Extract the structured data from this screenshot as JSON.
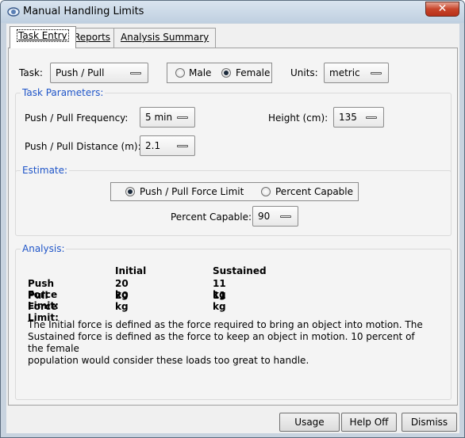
{
  "window": {
    "title": "Manual Handling Limits",
    "close_glyph": "✕"
  },
  "tabs": [
    {
      "label": "Task Entry",
      "active": true
    },
    {
      "label": "Reports",
      "active": false
    },
    {
      "label": "Analysis Summary",
      "active": false
    }
  ],
  "task_row": {
    "task_label": "Task:",
    "task_value": "Push / Pull",
    "male_label": "Male",
    "female_label": "Female",
    "gender_selected": "Female",
    "units_label": "Units:",
    "units_value": "metric"
  },
  "task_parameters": {
    "title": "Task Parameters:",
    "frequency_label": "Push / Pull Frequency:",
    "frequency_value": "5 min",
    "height_label": "Height (cm):",
    "height_value": "135",
    "distance_label": "Push / Pull Distance (m):",
    "distance_value": "2.1"
  },
  "estimate": {
    "title": "Estimate:",
    "option_force": "Push / Pull Force Limit",
    "option_percent": "Percent Capable",
    "selected": "Push / Pull Force Limit",
    "percent_label": "Percent Capable:",
    "percent_value": "90"
  },
  "analysis": {
    "title": "Analysis:",
    "col_initial": "Initial",
    "col_sustained": "Sustained",
    "rows": [
      {
        "label": "Push Force Limit:",
        "initial": "20 kg",
        "sustained": "11 kg"
      },
      {
        "label": "Pull Force Limit:",
        "initial": "20 kg",
        "sustained": "11 kg"
      }
    ],
    "note_lines": [
      "The Initial force is defined as the force required to bring an object into motion.  The",
      "Sustained force is defined as the force to keep an object in motion.  10 percent of the female",
      "population would consider these loads too great to handle."
    ]
  },
  "buttons": {
    "usage": "Usage",
    "help_off": "Help Off",
    "dismiss": "Dismiss"
  },
  "colors": {
    "group_title": "#1f55c8",
    "close_button": "#c7442a"
  }
}
